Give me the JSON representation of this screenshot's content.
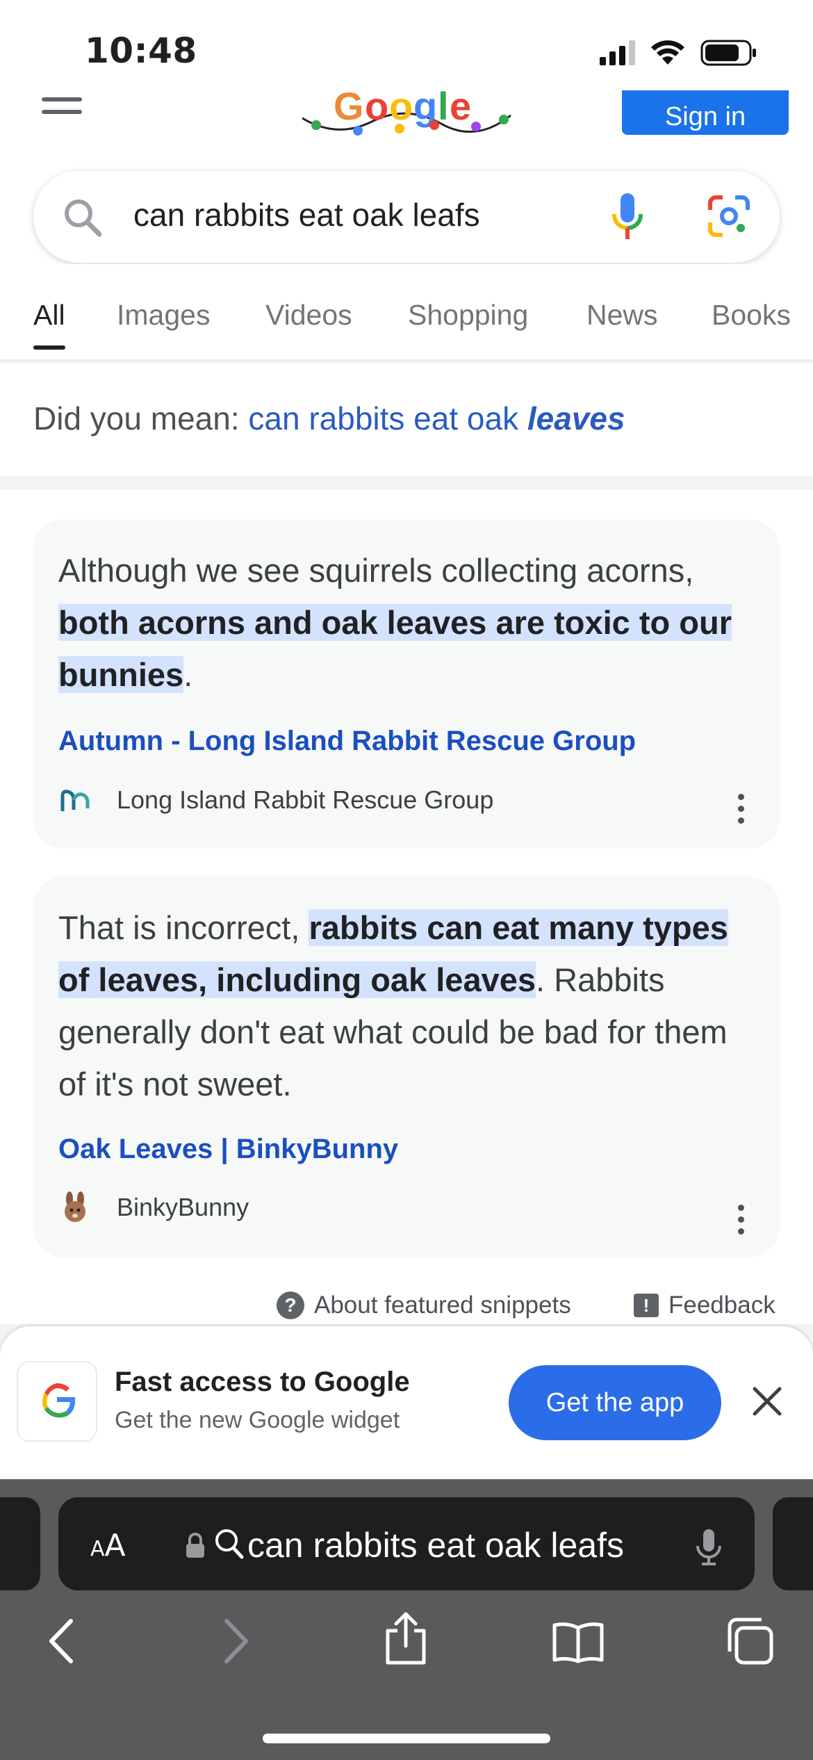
{
  "status_bar": {
    "time": "10:48"
  },
  "header": {
    "signin_label": "Sign in",
    "search_query": "can rabbits eat oak leafs"
  },
  "tabs": [
    {
      "label": "All",
      "active": true
    },
    {
      "label": "Images"
    },
    {
      "label": "Videos"
    },
    {
      "label": "Shopping"
    },
    {
      "label": "News"
    },
    {
      "label": "Books"
    }
  ],
  "did_you_mean": {
    "prefix": "Did you mean: ",
    "suggestion_plain": "can rabbits eat oak ",
    "suggestion_emph": "leaves"
  },
  "snippets": [
    {
      "text_before": "Although we see squirrels collecting acorns, ",
      "text_highlight": "both acorns and oak leaves are toxic to our bunnies",
      "text_after": ".",
      "link_title": "Autumn - Long Island Rabbit Rescue Group",
      "source": "Long Island Rabbit Rescue Group"
    },
    {
      "text_before": "That is incorrect, ",
      "text_highlight": "rabbits can eat many types of leaves, including oak leaves",
      "text_after": ". Rabbits generally don't eat what could be bad for them of it's not sweet.",
      "link_title": "Oak Leaves | BinkyBunny",
      "source": "BinkyBunny"
    }
  ],
  "snippet_footer": {
    "about_label": "About featured snippets",
    "feedback_label": "Feedback"
  },
  "promo": {
    "title": "Fast access to Google",
    "subtitle": "Get the new Google widget",
    "button_label": "Get the app"
  },
  "safari": {
    "aa_small": "A",
    "aa_big": "A",
    "address_text": "can rabbits eat oak leafs"
  },
  "colors": {
    "google_blue": "#1a73e8",
    "link_blue": "#1a4fbf",
    "highlight": "#d3e3fd",
    "safari_bar": "#5a5a5d"
  }
}
